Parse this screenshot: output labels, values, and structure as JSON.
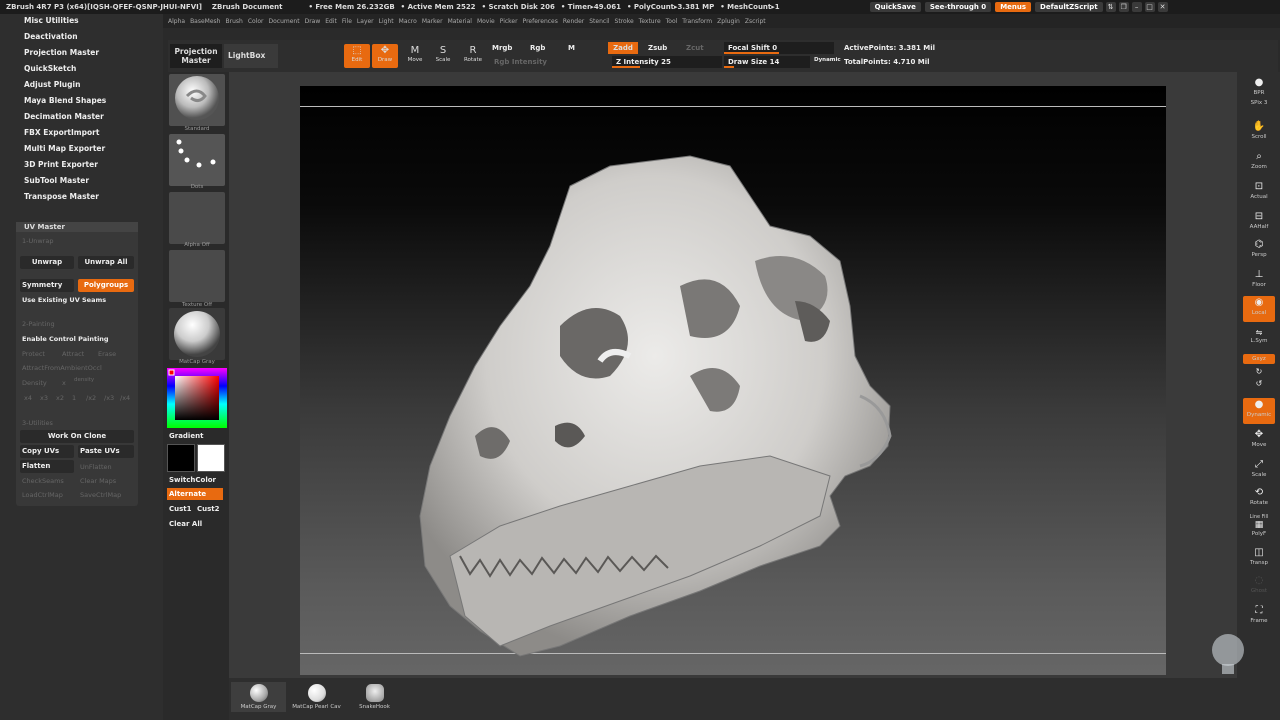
{
  "titlebar": {
    "app": "ZBrush 4R7 P3 (x64)[IQSH-QFEF-QSNP-JHUI-NFVI]",
    "document": "ZBrush Document",
    "free_mem": "• Free Mem 26.232GB",
    "active_mem": "• Active Mem 2522",
    "scratch": "• Scratch Disk 206",
    "timer": "• Timer▸49.061",
    "polycount": "• PolyCount▸3.381 MP",
    "meshcount": "• MeshCount▸1",
    "quicksave": "QuickSave",
    "seethrough": "See-through  0",
    "menus": "Menus",
    "script": "DefaultZScript"
  },
  "menubar": {
    "items": [
      "Alpha",
      "BaseMesh",
      "Brush",
      "Color",
      "Document",
      "Draw",
      "Edit",
      "File",
      "Layer",
      "Light",
      "Macro",
      "Marker",
      "Material",
      "Movie",
      "Picker",
      "Preferences",
      "Render",
      "Stencil",
      "Stroke",
      "Texture",
      "Tool",
      "Transform",
      "Zplugin",
      "Zscript"
    ]
  },
  "plugins": {
    "items": [
      "Misc Utilities",
      "Deactivation",
      "Projection Master",
      "QuickSketch",
      "Adjust Plugin",
      "Maya Blend Shapes",
      "Decimation Master",
      "FBX ExportImport",
      "Multi Map Exporter",
      "3D Print Exporter",
      "SubTool Master",
      "Transpose Master"
    ]
  },
  "uvmaster": {
    "title": "UV Master",
    "section_unwrap": "1-Unwrap",
    "unwrap": "Unwrap",
    "unwrap_all": "Unwrap All",
    "symmetry": "Symmetry",
    "polygroups": "Polygroups",
    "use_seams": "Use Existing UV Seams",
    "section_painting": "2-Painting",
    "enable_control": "Enable Control Painting",
    "protect": "Protect",
    "attract": "Attract",
    "erase": "Erase",
    "attract_ao": "AttractFromAmbientOccl",
    "density": "Density",
    "density_x": "x",
    "density_val": "density",
    "d4": "x4",
    "d3": "x3",
    "d2": "x2",
    "d1": "1",
    "e2": "/x2",
    "e3": "/x3",
    "e4": "/x4",
    "section_utilities": "3-Utilities",
    "work_on_clone": "Work On Clone",
    "copy_uvs": "Copy UVs",
    "paste_uvs": "Paste UVs",
    "flatten": "Flatten",
    "unflatten": "UnFlatten",
    "check_seams": "CheckSeams",
    "clear_maps": "Clear Maps",
    "load_ctrl": "LoadCtrlMap",
    "save_ctrl": "SaveCtrlMap"
  },
  "toolshelf": {
    "standard": "Standard",
    "dots": "Dots",
    "alpha_off": "Alpha  Off",
    "texture_off": "Texture  Off",
    "matcap": "MatCap  Gray",
    "gradient": "Gradient",
    "switch_color": "SwitchColor",
    "alternate": "Alternate",
    "cust1": "Cust1",
    "cust2": "Cust2",
    "clear_all": "Clear All"
  },
  "topbar": {
    "projection_master": "Projection Master",
    "lightbox": "LightBox",
    "edit": "Edit",
    "draw": "Draw",
    "move": "Move",
    "scale": "Scale",
    "rotate": "Rotate",
    "mrgb": "Mrgb",
    "rgb": "Rgb",
    "m": "M",
    "rgb_intensity": "Rgb  Intensity",
    "zadd": "Zadd",
    "zsub": "Zsub",
    "zcut": "Zcut",
    "z_intensity": "Z Intensity 25",
    "focal_shift": "Focal Shift 0",
    "draw_size": "Draw Size 14",
    "dynamic": "Dynamic",
    "active_points": "ActivePoints: 3.381  Mil",
    "total_points": "TotalPoints: 4.710  Mil"
  },
  "rightshelf": {
    "bpr": "BPR",
    "spix": "SPix 3",
    "scroll": "Scroll",
    "zoom": "Zoom",
    "actual": "Actual",
    "aahalf": "AAHalf",
    "persp": "Persp",
    "floor": "Floor",
    "local": "Local",
    "lsym": "L.Sym",
    "xyz": "Gxyz",
    "frame": "Frame",
    "move": "Move",
    "scale": "Scale",
    "rotate": "Rotate",
    "polyf": "PolyF",
    "transp": "Transp",
    "ghost": "Ghost",
    "dynamic": "Dynamic",
    "line_fill": "Line Fill"
  },
  "bottombar": {
    "mat1": "MatCap Gray",
    "mat2": "MatCap Pearl Cav",
    "mat3": "SnakeHook"
  },
  "colors": {
    "accent": "#e86a10",
    "panel": "#2e2e2e",
    "button": "#2a2a2a"
  }
}
